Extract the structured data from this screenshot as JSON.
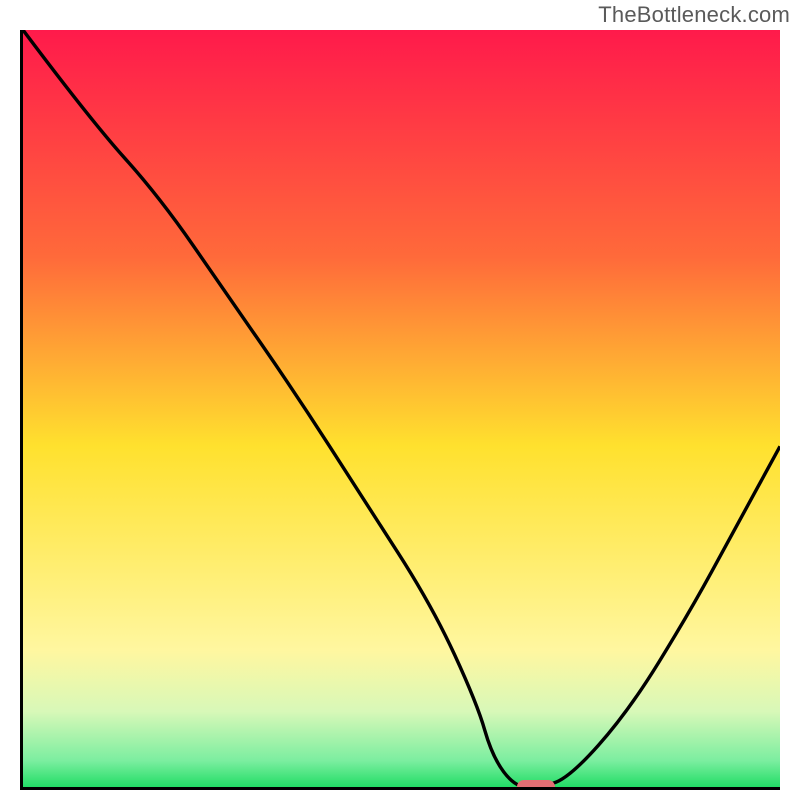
{
  "watermark": "TheBottleneck.com",
  "colors": {
    "top": "#ff1a4b",
    "mid_red_orange": "#ff6a3a",
    "mid_orange": "#ffa531",
    "mid_yellow": "#ffe12e",
    "pale_yellow": "#fff7a0",
    "pale_green": "#c9f7b1",
    "green": "#29e06a",
    "curve": "#000000",
    "marker": "#e36f74",
    "axis": "#000000"
  },
  "chart_data": {
    "type": "line",
    "title": "",
    "xlabel": "",
    "ylabel": "",
    "xlim": [
      0,
      100
    ],
    "ylim": [
      0,
      100
    ],
    "grid": false,
    "legend": false,
    "annotations": [
      "TheBottleneck.com"
    ],
    "series": [
      {
        "name": "bottleneck-curve",
        "x": [
          0,
          9,
          18,
          27,
          36,
          45,
          54,
          60,
          62,
          65,
          68,
          72,
          80,
          88,
          94,
          100
        ],
        "y": [
          100,
          88,
          78,
          65,
          52,
          38,
          24,
          11,
          4,
          0,
          0,
          1,
          10,
          23,
          34,
          45
        ]
      }
    ],
    "marker": {
      "x_start": 65,
      "x_end": 70,
      "y": 0
    },
    "background_gradient_stops": [
      {
        "pos": 0.0,
        "color": "#ff1a4b"
      },
      {
        "pos": 0.3,
        "color": "#ff6a3a"
      },
      {
        "pos": 0.55,
        "color": "#ffe12e"
      },
      {
        "pos": 0.82,
        "color": "#fff7a0"
      },
      {
        "pos": 0.9,
        "color": "#d8f8b8"
      },
      {
        "pos": 0.965,
        "color": "#7ceea0"
      },
      {
        "pos": 1.0,
        "color": "#22dd66"
      }
    ]
  }
}
